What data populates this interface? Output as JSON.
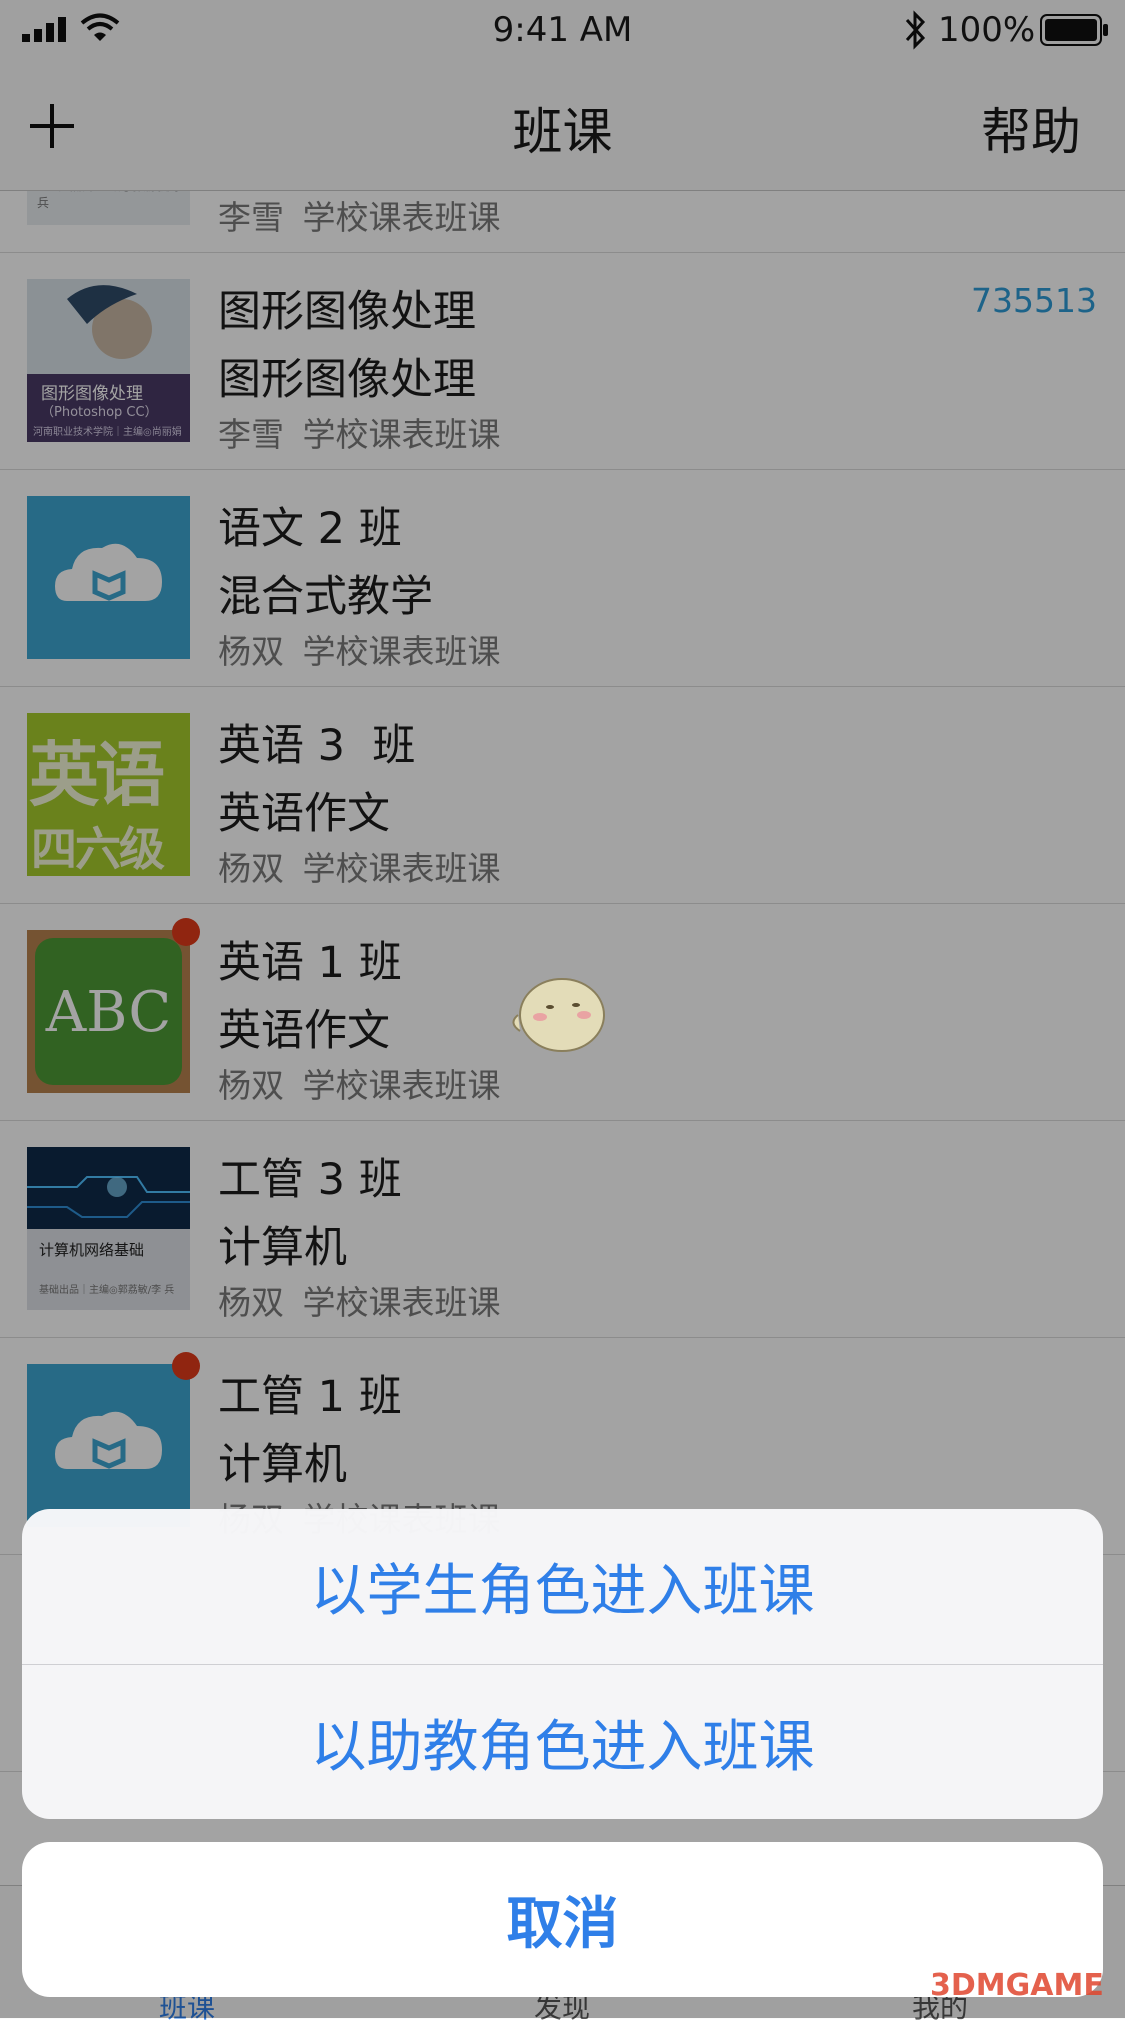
{
  "status": {
    "time": "9:41 AM",
    "battery": "100%"
  },
  "nav": {
    "title": "班课",
    "help": "帮助"
  },
  "items": [
    {
      "title": "",
      "subtitle": "",
      "meta": "李雪  学校课表班课",
      "code": "",
      "thumb_text": "",
      "thumb_caption": "基础出品｜主编◎郭荔敏/李 兵"
    },
    {
      "title": "图形图像处理",
      "subtitle": "图形图像处理",
      "meta": "李雪  学校课表班课",
      "code": "735513",
      "thumb_text": "图形图像处理",
      "thumb_sub": "（Photoshop CC）",
      "thumb_caption": "河南职业技术学院｜主编◎尚丽娟"
    },
    {
      "title": "语文 2 班",
      "subtitle": "混合式教学",
      "meta": "杨双  学校课表班课",
      "code": ""
    },
    {
      "title": "英语 3  班",
      "subtitle": "英语作文",
      "meta": "杨双  学校课表班课",
      "code": "",
      "thumb_text": "英语",
      "thumb_sub": "四六级"
    },
    {
      "title": "英语 1 班",
      "subtitle": "英语作文",
      "meta": "杨双  学校课表班课",
      "code": "",
      "thumb_text": "ABC"
    },
    {
      "title": "工管 3 班",
      "subtitle": "计算机",
      "meta": "杨双  学校课表班课",
      "code": "",
      "thumb_text": "计算机网络基础",
      "thumb_caption": "基础出品｜主编◎郭荔敏/李 兵"
    },
    {
      "title": "工管 1 班",
      "subtitle": "计算机",
      "meta": "杨双  学校课表班课",
      "code": ""
    }
  ],
  "tabs": [
    "班课",
    "发现",
    "我的"
  ],
  "sheet": {
    "student": "以学生角色进入班课",
    "assistant": "以助教角色进入班课",
    "cancel": "取消"
  },
  "watermark": "3DMGAME",
  "colors": {
    "accent": "#2f7fe8",
    "badge": "#e23a1a",
    "code": "#2e9bd6"
  }
}
